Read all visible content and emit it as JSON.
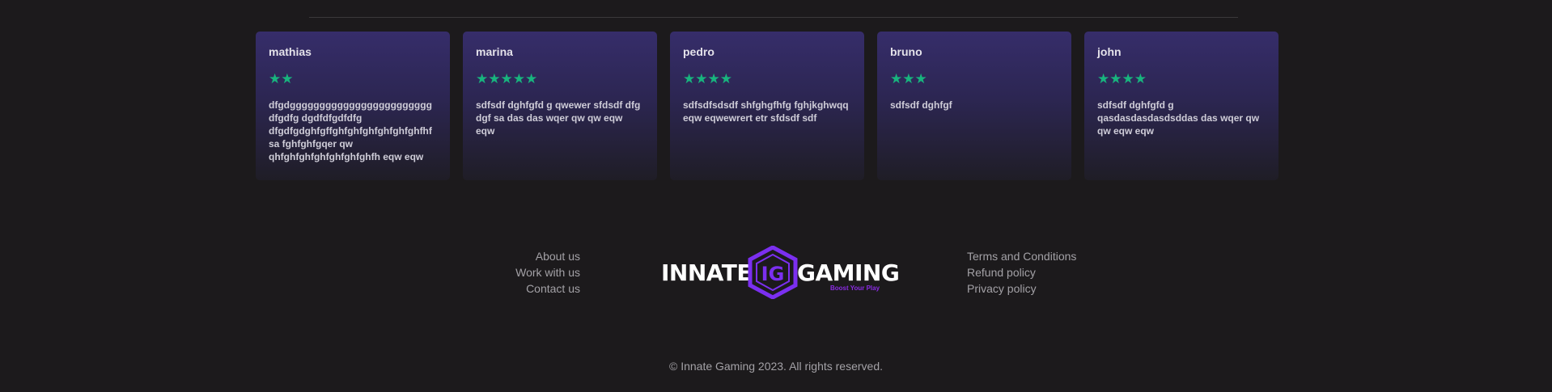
{
  "reviews": [
    {
      "name": "mathias",
      "rating": 2,
      "stars": "★★",
      "text": "dfgdgggggggggggggggggggggggg dfgdfg dgdfdfgdfdfg dfgdfgdghfgffghfghfghfghfghfghfhfsa fghfghfgqer  qw qhfghfghfghfghfghfghfh eqw eqw"
    },
    {
      "name": "marina",
      "rating": 5,
      "stars": "★★★★★",
      "text": "sdfsdf dghfgfd g qwewer  sfdsdf  dfg dgf sa das das wqer  qw qw eqw eqw"
    },
    {
      "name": "pedro",
      "rating": 4,
      "stars": "★★★★",
      "text": "sdfsdfsdsdf shfghgfhfg fghjkghwqq eqw eqwewrert etr sfdsdf sdf"
    },
    {
      "name": "bruno",
      "rating": 3,
      "stars": "★★★",
      "text": "sdfsdf dghfgf"
    },
    {
      "name": "john",
      "rating": 4,
      "stars": "★★★★",
      "text": "sdfsdf dghfgfd g qasdasdasdasdsddas das wqer  qw qw eqw eqw"
    }
  ],
  "footer": {
    "left_links": [
      "About us",
      "Work with us",
      "Contact us"
    ],
    "right_links": [
      "Terms and Conditions",
      "Refund policy",
      "Privacy policy"
    ],
    "logo": {
      "left_word": "INNATE",
      "right_word": "GAMING",
      "tagline": "Boost Your Play",
      "badge_letters": "IG",
      "accent_color": "#7b2ff0"
    },
    "copyright": "© Innate Gaming 2023. All rights reserved."
  },
  "colors": {
    "background": "#1c1a1c",
    "star": "#18b47e",
    "card_top": "#362d6a",
    "link": "#a3a1a6"
  }
}
